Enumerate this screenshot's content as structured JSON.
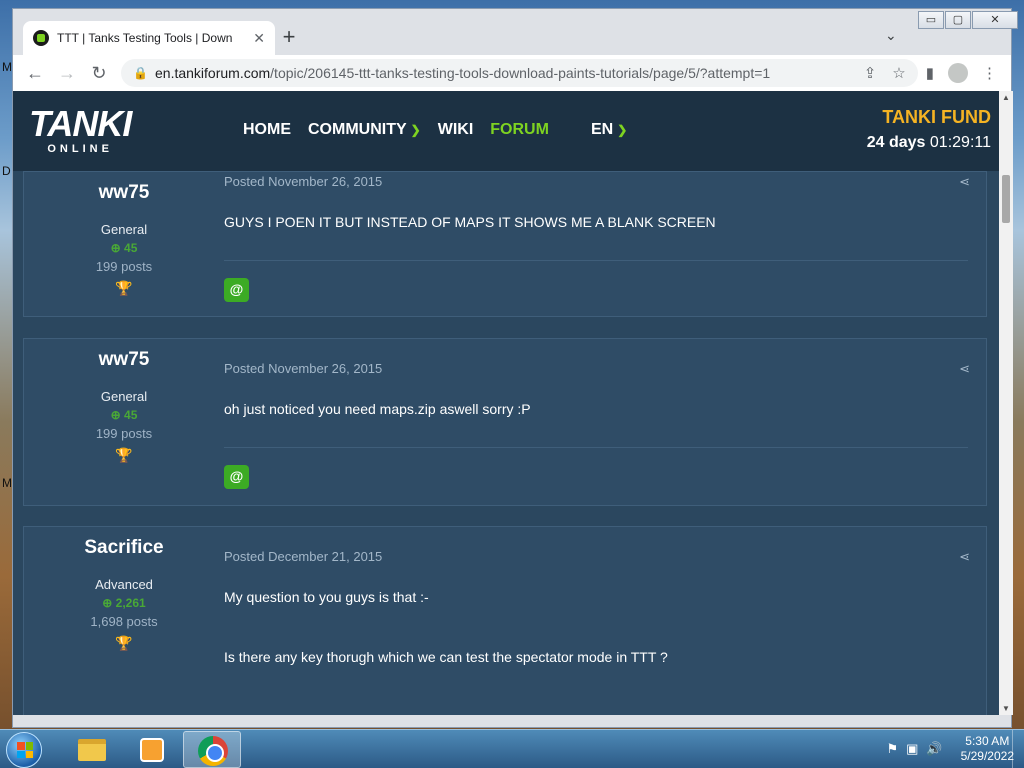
{
  "desktop": {
    "side_letters": [
      "M",
      "D",
      "M"
    ]
  },
  "browser": {
    "tab": {
      "title": "TTT | Tanks Testing Tools | Download Paints Tutorials",
      "close": "✕"
    },
    "new_tab": "+",
    "tab_menu": "⌄",
    "window_controls": {
      "minimize": "▭",
      "maximize": "▢",
      "close": "✕"
    },
    "nav": {
      "back": "←",
      "forward": "→",
      "reload": "↻"
    },
    "url": {
      "host": "en.tankiforum.com",
      "path": "/topic/206145-ttt-tanks-testing-tools-download-paints-tutorials/page/5/?attempt=1"
    }
  },
  "site": {
    "logo_main": "TANKI",
    "logo_sub": "ONLINE",
    "nav": [
      {
        "label": "HOME"
      },
      {
        "label": "COMMUNITY"
      },
      {
        "label": "WIKI"
      },
      {
        "label": "FORUM"
      }
    ],
    "lang": "EN",
    "fund_title": "TANKI FUND",
    "fund_days": "24 days",
    "fund_time": "01:29:11"
  },
  "posts": [
    {
      "author": "ww75",
      "rank": "General",
      "rep": "45",
      "posts": "199 posts",
      "date": "Posted November 26, 2015",
      "lines": [
        "GUYS I POEN IT BUT INSTEAD OF MAPS IT SHOWS ME A BLANK SCREEN"
      ],
      "mention": "@"
    },
    {
      "author": "ww75",
      "rank": "General",
      "rep": "45",
      "posts": "199 posts",
      "date": "Posted November 26, 2015",
      "lines": [
        "oh just noticed you need maps.zip aswell sorry :P"
      ],
      "mention": "@"
    },
    {
      "author": "Sacrifice",
      "rank": "Advanced",
      "rep": "2,261",
      "posts": "1,698 posts",
      "date": "Posted December 21, 2015",
      "lines": [
        "My question to you guys is that :-",
        "",
        "",
        "Is there any key thorugh which we can test the spectator mode in TTT ?"
      ],
      "mention": "@"
    }
  ],
  "taskbar": {
    "time": "5:30 AM",
    "date": "5/29/2022"
  }
}
